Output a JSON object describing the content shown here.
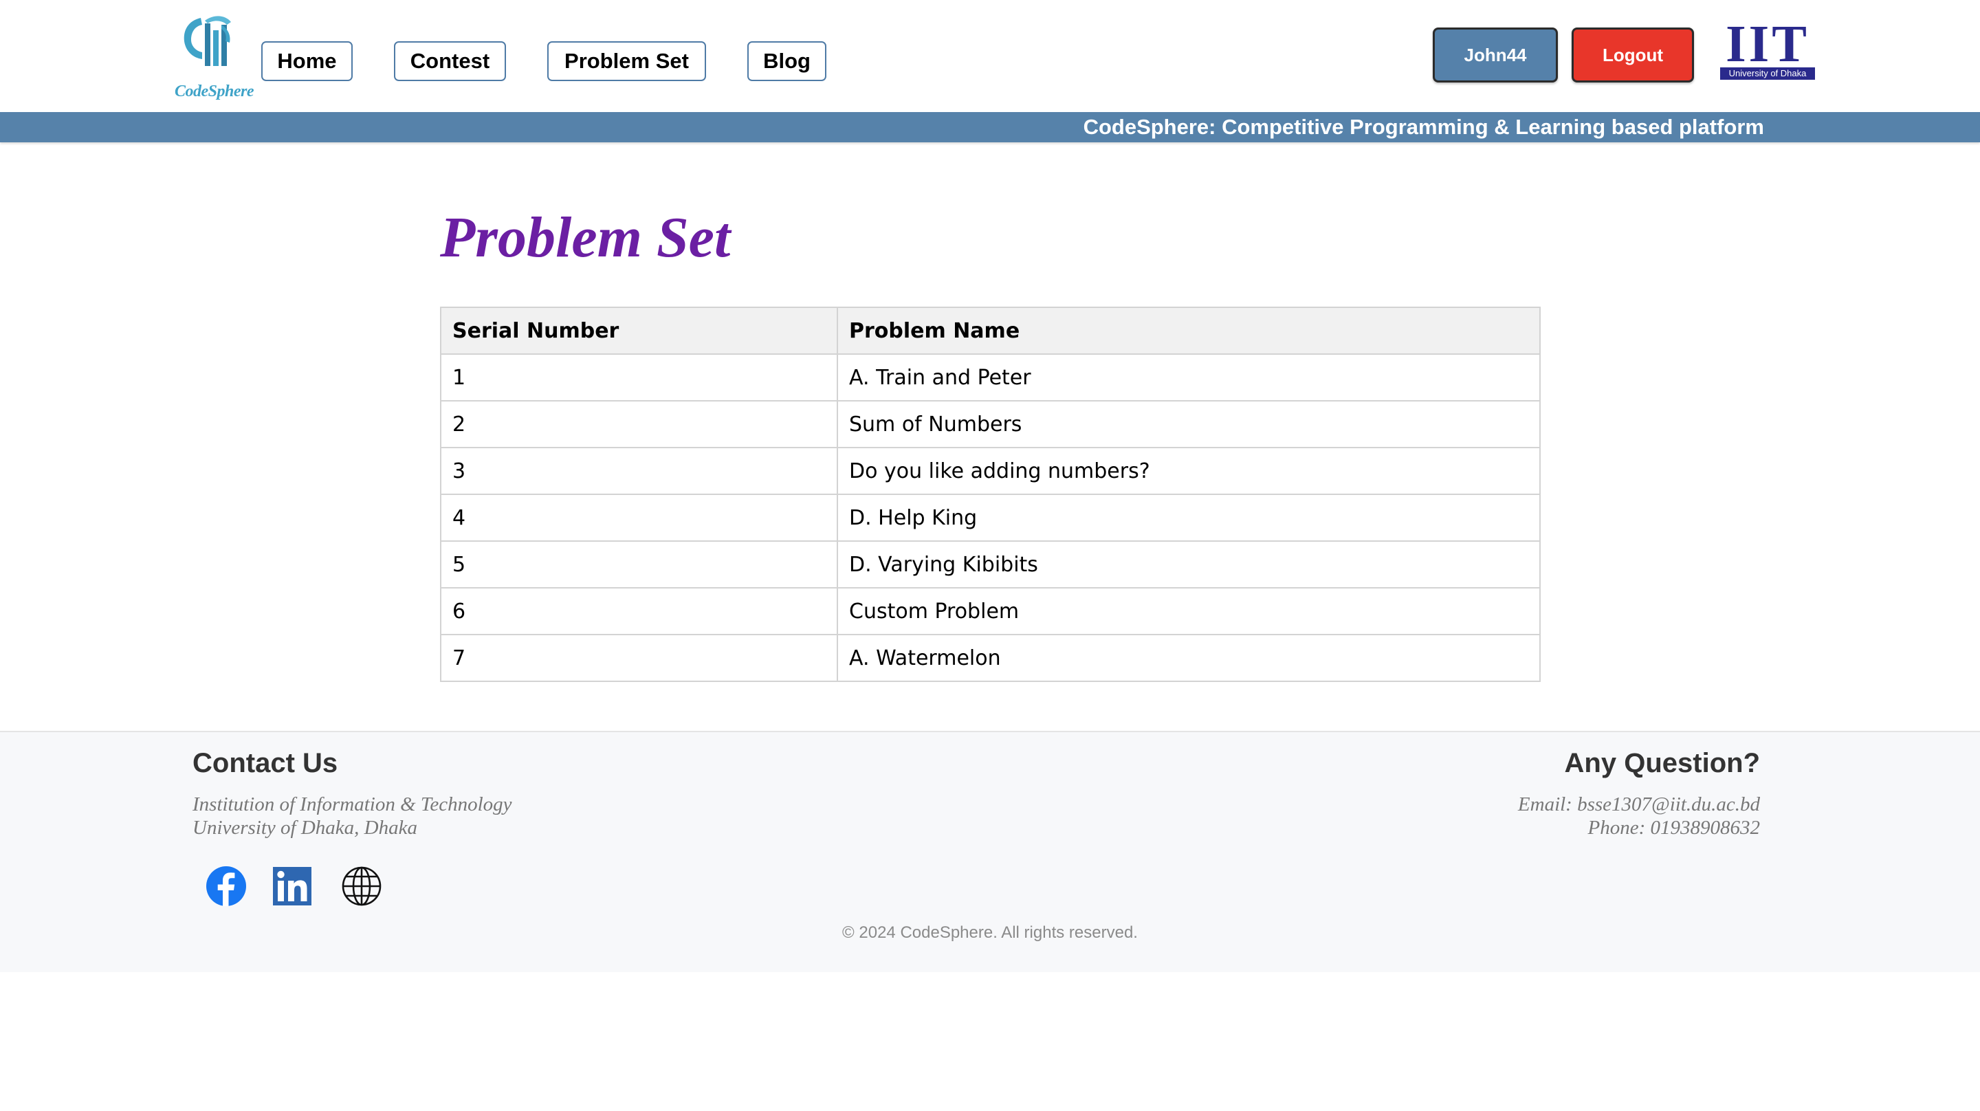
{
  "header": {
    "logo_text": "CodeSphere",
    "nav": [
      {
        "label": "Home"
      },
      {
        "label": "Contest"
      },
      {
        "label": "Problem Set"
      },
      {
        "label": "Blog"
      }
    ],
    "user_label": "John44",
    "logout_label": "Logout",
    "iit_logo": {
      "letters": "IIT",
      "subtitle": "University of Dhaka"
    },
    "banner": "CodeSphere: Competitive Programming & Learning based platform"
  },
  "main": {
    "title": "Problem Set",
    "columns": [
      "Serial Number",
      "Problem Name"
    ],
    "rows": [
      {
        "serial": "1",
        "name": "A. Train and Peter"
      },
      {
        "serial": "2",
        "name": "Sum of Numbers"
      },
      {
        "serial": "3",
        "name": "Do you like adding numbers?"
      },
      {
        "serial": "4",
        "name": "D. Help King"
      },
      {
        "serial": "5",
        "name": "D. Varying Kibibits"
      },
      {
        "serial": "6",
        "name": "Custom Problem"
      },
      {
        "serial": "7",
        "name": "A. Watermelon"
      }
    ]
  },
  "footer": {
    "contact_title": "Contact Us",
    "address_line1": "Institution of Information & Technology",
    "address_line2": "University of Dhaka, Dhaka",
    "question_title": "Any Question?",
    "email": "Email: bsse1307@iit.du.ac.bd",
    "phone": "Phone: 01938908632",
    "social_icons": [
      "facebook-icon",
      "linkedin-icon",
      "globe-icon"
    ],
    "copyright": "© 2024 CodeSphere. All rights reserved."
  },
  "colors": {
    "accent": "#5682aa",
    "logout": "#e8362a",
    "title": "#6b1fa3",
    "iit_blue": "#2a2a8c"
  }
}
